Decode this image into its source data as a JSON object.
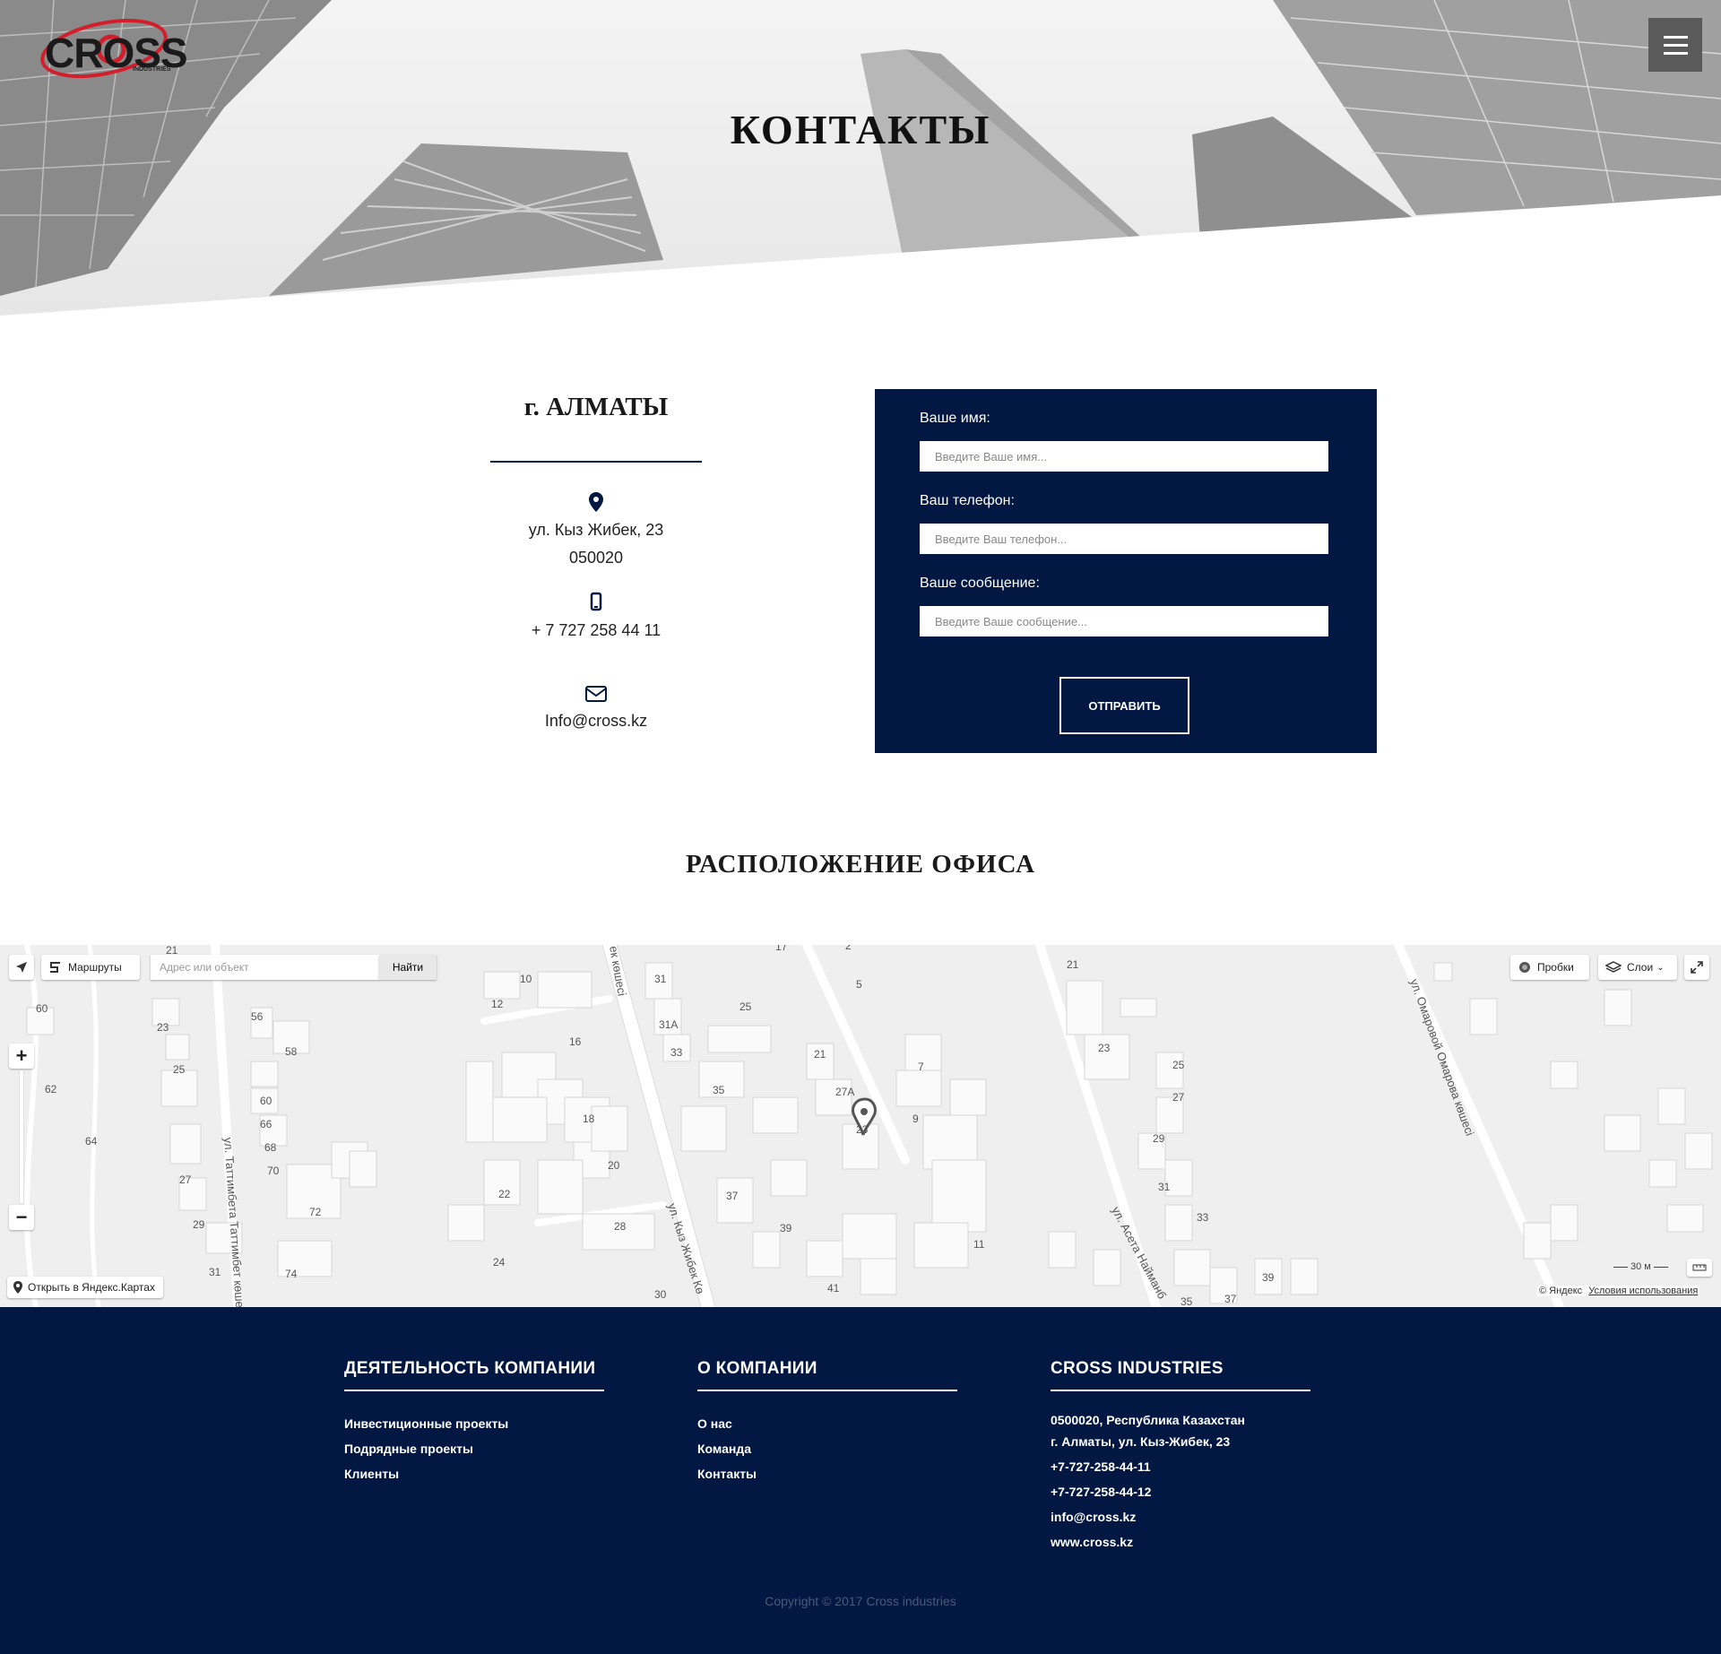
{
  "brand": {
    "logo_text": "CROSS",
    "logo_sub": "INDUSTRIES",
    "accent": "#d21f2b"
  },
  "header": {
    "title": "КОНТАКТЫ",
    "menu_icon": "hamburger-icon"
  },
  "contacts": {
    "city": "г. АЛМАТЫ",
    "address_line1": "ул. Кыз Жибек, 23",
    "address_line2": "050020",
    "phone": "+ 7 727 258 44 11",
    "email": "Info@cross.kz",
    "icons": [
      "map-pin-icon",
      "mobile-phone-icon",
      "envelope-icon"
    ]
  },
  "form": {
    "name_label": "Ваше имя:",
    "name_placeholder": "Введите Ваше имя...",
    "phone_label": "Ваш телефон:",
    "phone_placeholder": "Введите Ваш телефон...",
    "message_label": "Ваше сообщение:",
    "message_placeholder": "Введите Ваше сообщение...",
    "submit_label": "ОТПРАВИТЬ",
    "bg_color": "#021741"
  },
  "office": {
    "title": "РАСПОЛОЖЕНИЕ ОФИСА"
  },
  "map": {
    "routes_label": "Маршруты",
    "search_placeholder": "Адрес или объект",
    "find_label": "Найти",
    "traffic_label": "Пробки",
    "layers_label": "Слои",
    "open_label": "Открыть в Яндекс.Картах",
    "scale_label": "30 м",
    "copyright": "© Яндекс",
    "terms": "Условия использования",
    "streets": [
      "ул. Кыз Жибек Кө",
      "ул. Таттимбета Таттимбет көшесі",
      "ул. Асета Найманб",
      "ул. Омаровой Омарова көшесі",
      "ек көшесі"
    ],
    "house_numbers": [
      "21",
      "60",
      "23",
      "56",
      "58",
      "25",
      "62",
      "60",
      "66",
      "68",
      "64",
      "70",
      "27",
      "72",
      "29",
      "31",
      "74",
      "10",
      "12",
      "16",
      "18",
      "20",
      "22",
      "24",
      "28",
      "30",
      "31",
      "31А",
      "33",
      "25",
      "35",
      "37",
      "39",
      "41",
      "21",
      "27А",
      "23",
      "5",
      "7",
      "9",
      "11",
      "21",
      "23",
      "25",
      "27",
      "29",
      "31",
      "33",
      "35",
      "37",
      "39",
      "2",
      "17"
    ]
  },
  "footer": {
    "col1": {
      "title": "ДЕЯТЕЛЬНОСТЬ КОМПАНИИ",
      "items": [
        "Инвестиционные проекты",
        "Подрядные проекты",
        "Клиенты"
      ]
    },
    "col2": {
      "title": "О КОМПАНИИ",
      "items": [
        "О нас",
        "Команда",
        "Контакты"
      ]
    },
    "col3": {
      "title": "CROSS INDUSTRIES",
      "address1": "0500020, Республика Казахстан",
      "address2": "г. Алматы, ул. Кыз-Жибек, 23",
      "phone1": "+7-727-258-44-11",
      "phone2": "+7-727-258-44-12",
      "email": "info@cross.kz",
      "site": "www.cross.kz"
    },
    "copyright": "Copyright © 2017 Cross industries"
  }
}
